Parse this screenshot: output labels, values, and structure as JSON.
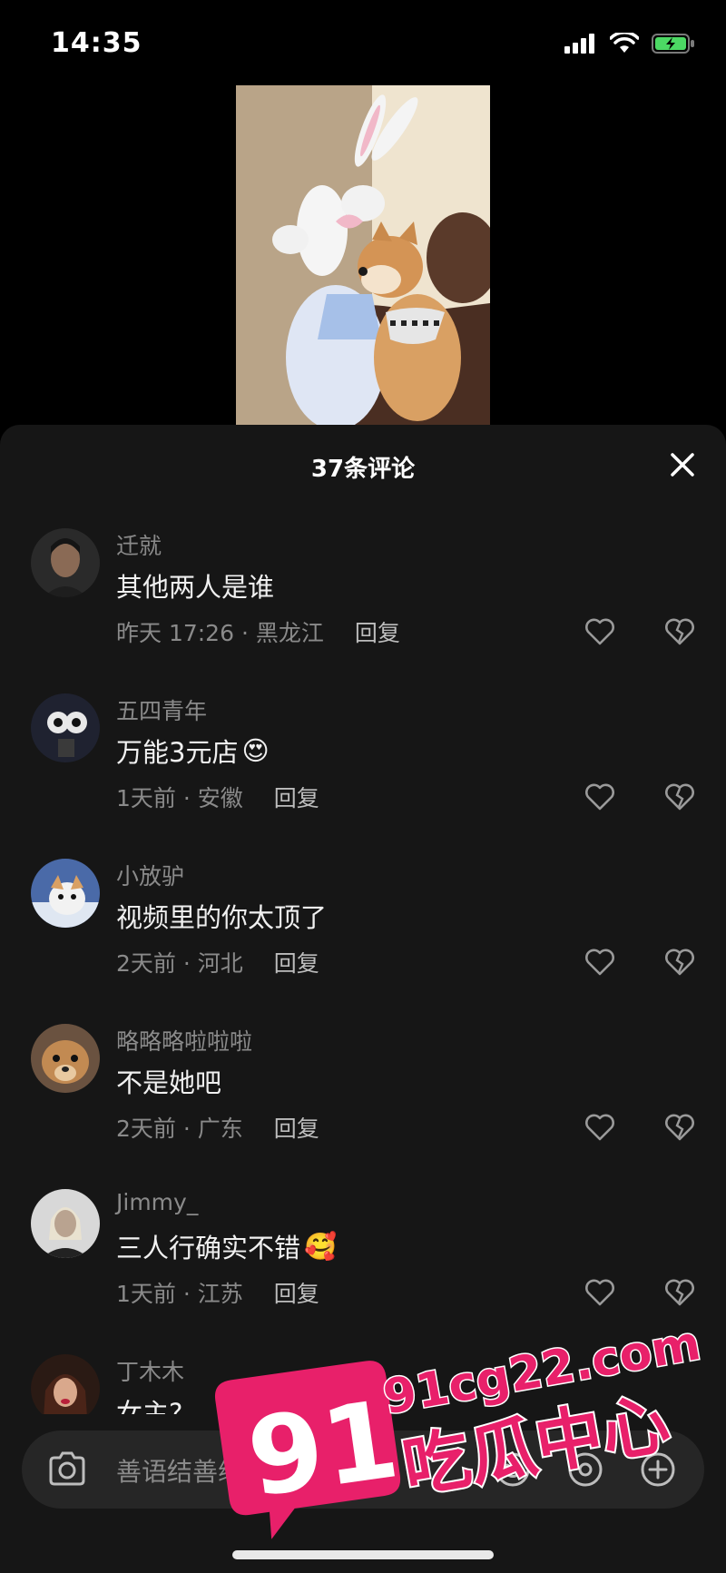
{
  "status_bar": {
    "time": "14:35"
  },
  "sheet": {
    "title": "37条评论",
    "close_icon": "close-icon"
  },
  "comments": [
    {
      "username": "迁就",
      "text": "其他两人是谁",
      "emoji": "",
      "time": "昨天 17:26 · 黑龙江",
      "reply": "回复",
      "avatar": "#3a3a3a"
    },
    {
      "username": "五四青年",
      "text": "万能3元店",
      "emoji": "😍",
      "time": "1天前 · 安徽",
      "reply": "回复",
      "avatar": "#262a3a"
    },
    {
      "username": "小放驴",
      "text": "视频里的你太顶了",
      "emoji": "",
      "time": "2天前 · 河北",
      "reply": "回复",
      "avatar": "#5c7ab0"
    },
    {
      "username": "略略略啦啦啦",
      "text": "不是她吧",
      "emoji": "",
      "time": "2天前 · 广东",
      "reply": "回复",
      "avatar": "#9b7550"
    },
    {
      "username": "Jimmy_",
      "text": "三人行确实不错",
      "emoji": "🥰",
      "time": "1天前 · 江苏",
      "reply": "回复",
      "avatar": "#cfcfcf"
    },
    {
      "username": "丁木木",
      "text": "女主?",
      "emoji": "",
      "time": "",
      "reply": "",
      "avatar": "#5a2d1a"
    }
  ],
  "input": {
    "placeholder": "善语结善缘，恶言伤人心"
  },
  "watermark": {
    "number": "91",
    "url": "91cg22.com",
    "name": "吃瓜中心"
  },
  "colors": {
    "background": "#000000",
    "sheet": "#161616",
    "watermark_pink": "#e8206a"
  }
}
